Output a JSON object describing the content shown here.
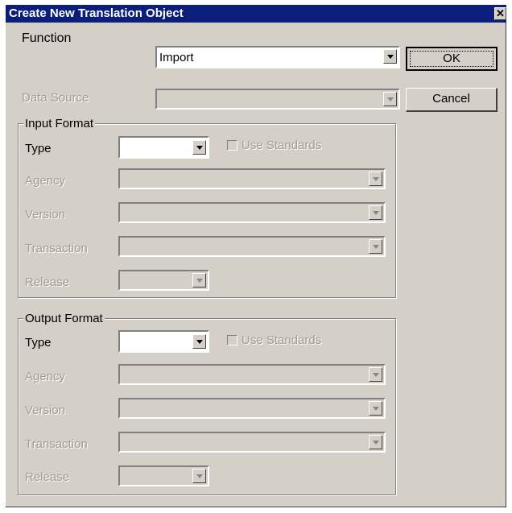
{
  "window": {
    "title": "Create New Translation Object",
    "close_glyph": "✕"
  },
  "function": {
    "label": "Function",
    "value": "Import"
  },
  "data_source": {
    "label": "Data Source",
    "value": ""
  },
  "buttons": {
    "ok": "OK",
    "cancel": "Cancel"
  },
  "input_format": {
    "group_label": "Input Format",
    "type_label": "Type",
    "type_value": "",
    "use_standards_label": "Use Standards",
    "use_standards_checked": false,
    "agency_label": "Agency",
    "version_label": "Version",
    "transaction_label": "Transaction",
    "release_label": "Release"
  },
  "output_format": {
    "group_label": "Output Format",
    "type_label": "Type",
    "type_value": "",
    "use_standards_label": "Use Standards",
    "use_standards_checked": false,
    "agency_label": "Agency",
    "version_label": "Version",
    "transaction_label": "Transaction",
    "release_label": "Release"
  },
  "colors": {
    "titlebar": "#0a1e7a",
    "dialog_bg": "#d4d0c8",
    "disabled_text": "#a09c94"
  }
}
